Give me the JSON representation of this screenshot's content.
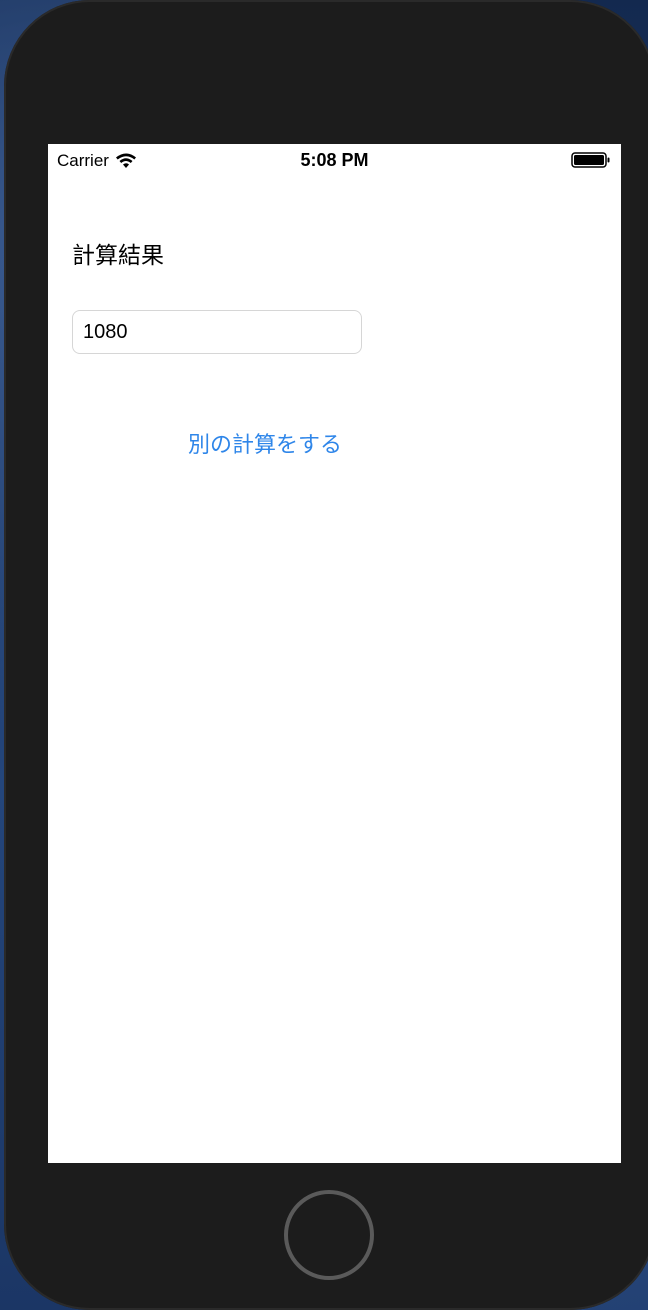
{
  "status_bar": {
    "carrier": "Carrier",
    "time": "5:08 PM",
    "icons": {
      "signal": "wifi-icon",
      "battery": "battery-icon"
    }
  },
  "screen": {
    "result_label": "計算結果",
    "result_value": "1080",
    "recalc_button_label": "別の計算をする"
  },
  "colors": {
    "accent": "#2f86e9",
    "device_bezel": "#1c1c1c",
    "screen_bg": "#ffffff"
  }
}
